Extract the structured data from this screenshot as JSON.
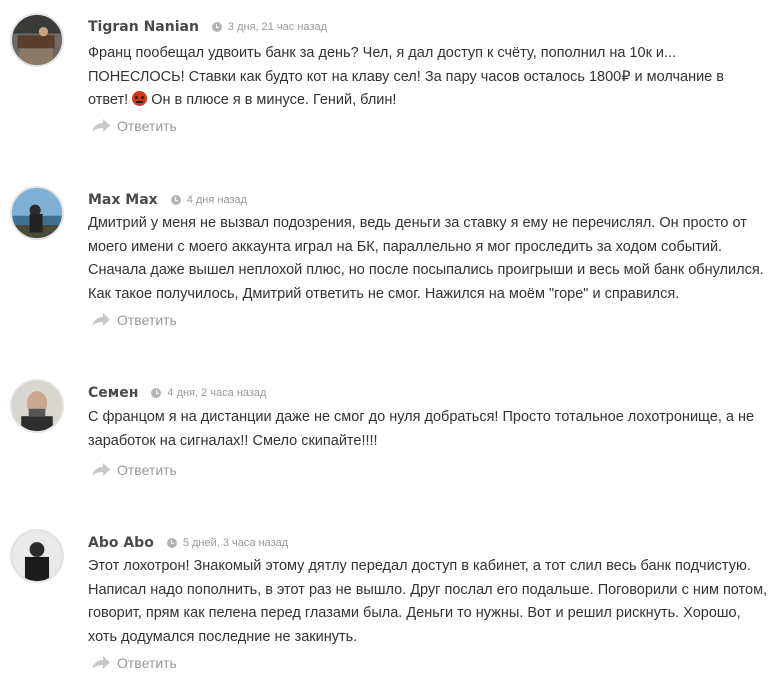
{
  "comments": [
    {
      "author": "Tigran Nanian",
      "date": "3 дня, 21 час назад",
      "text_before_emoji": "Франц пообещал удвоить банк за день? Чел, я дал доступ к счёту, пополнил на 10к и... ПОНЕСЛОСЬ! Ставки как будто кот на клаву сел! За пару часов осталось 1800₽ и молчание в ответ! ",
      "emoji": "angry-face-icon",
      "text_after_emoji": " Он в плюсе я в минусе. Гений, блин!",
      "reply_label": "Ответить"
    },
    {
      "author": "Max Max",
      "date": "4 дня назад",
      "text": "Дмитрий у меня не вызвал подозрения, ведь деньги за ставку я ему не перечислял. Он просто от моего имени с моего аккаунта играл на БК, параллельно я мог проследить за ходом событий. Сначала даже вышел неплохой плюс, но после посыпались проигрыши и весь мой банк обнулился. Как такое получилось, Дмитрий ответить не смог. Нажился на моём \"горе\" и справился.",
      "reply_label": "Ответить"
    },
    {
      "author": "Семен",
      "date": "4 дня, 2 часа назад",
      "text": "С францом я на дистанции даже не смог до нуля добраться! Просто тотальное лохотронище, а не заработок на сигналах!! Смело скипайте!!!!",
      "reply_label": "Ответить"
    },
    {
      "author": "Abo Abo",
      "date": "5 дней, 3 часа назад",
      "text": "Этот лохотрон! Знакомый этому дятлу передал доступ в кабинет, а тот слил весь банк подчистую. Написал надо пополнить, в этот раз не вышло. Друг послал его подальше. Поговорили с ним потом, говорит, прям как пелена перед глазами была. Деньги то нужны. Вот и решил рискнуть. Хорошо, хоть додумался последние не закинуть.",
      "reply_label": "Ответить"
    }
  ]
}
